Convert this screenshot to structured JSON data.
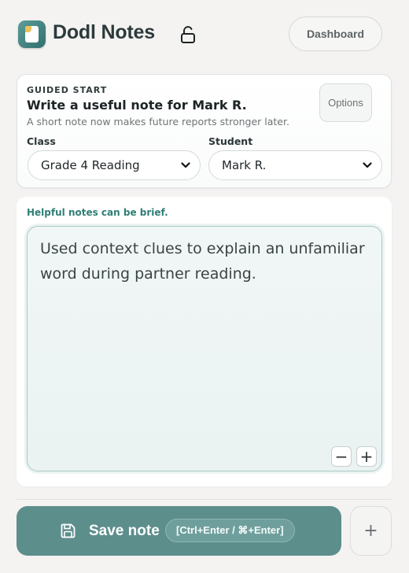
{
  "header": {
    "brand": "Dodl Notes",
    "lock_icon": "unlock-icon",
    "dashboard_label": "Dashboard"
  },
  "guided": {
    "eyebrow": "GUIDED START",
    "title": "Write a useful note for Mark R.",
    "subtitle": "A short note now makes future reports stronger later.",
    "options_label": "Options",
    "class_label": "Class",
    "class_value": "Grade 4 Reading",
    "student_label": "Student",
    "student_value": "Mark R."
  },
  "note": {
    "hint": "Helpful notes can be brief.",
    "text": "Used context clues to explain an unfamiliar word during partner reading.",
    "zoom_out": "−",
    "zoom_in": "+"
  },
  "footer": {
    "save_label": "Save note",
    "shortcut": "[Ctrl+Enter / ⌘+Enter]",
    "add_label": "+",
    "save_icon": "floppy-disk-icon"
  },
  "colors": {
    "accent": "#5c8e8c",
    "hint": "#2f7f76",
    "background": "#f4f3f2"
  }
}
